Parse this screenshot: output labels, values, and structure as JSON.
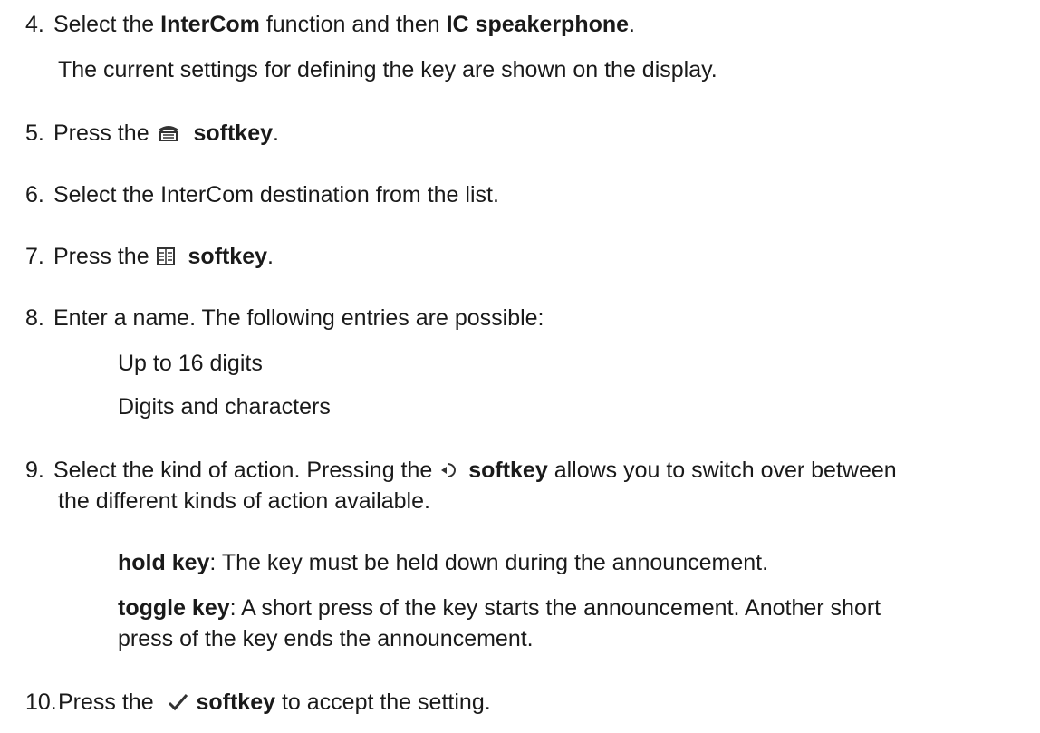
{
  "step4": {
    "number": "4.",
    "prefix": "Select the ",
    "function_name": "InterCom",
    "middle": " function and then ",
    "option_name": "IC speakerphone",
    "suffix": ".",
    "note": "The current settings for defining the key are shown on the display."
  },
  "step5": {
    "number": "5.",
    "prefix": "Press the ",
    "icon": "phone-list-icon",
    "softkey": "softkey",
    "suffix": "."
  },
  "step6": {
    "number": "6.",
    "text": "Select the InterCom destination from the list."
  },
  "step7": {
    "number": "7.",
    "prefix": "Press the ",
    "icon": "phonebook-icon",
    "softkey": "softkey",
    "suffix": "."
  },
  "step8": {
    "number": "8.",
    "text": "Enter a name. The following entries are possible:",
    "entries": [
      "Up to 16 digits",
      "Digits and characters"
    ]
  },
  "step9": {
    "number": "9.",
    "prefix": "Select the kind of action. Pressing the ",
    "icon": "toggle-cycle-icon",
    "softkey": "softkey",
    "suffix": " allows you to switch over between",
    "line2": "the different kinds of action available.",
    "hold_term": "hold key",
    "hold_desc": ": The key must be held down during the announcement.",
    "toggle_term": "toggle key",
    "toggle_desc_line1": ": A short press of the key starts the announcement. Another short",
    "toggle_desc_line2": "press of the key ends the announcement."
  },
  "step10": {
    "number": "10.",
    "prefix": "Press the ",
    "icon": "checkmark-icon",
    "softkey": "softkey",
    "suffix": " to accept the setting."
  }
}
